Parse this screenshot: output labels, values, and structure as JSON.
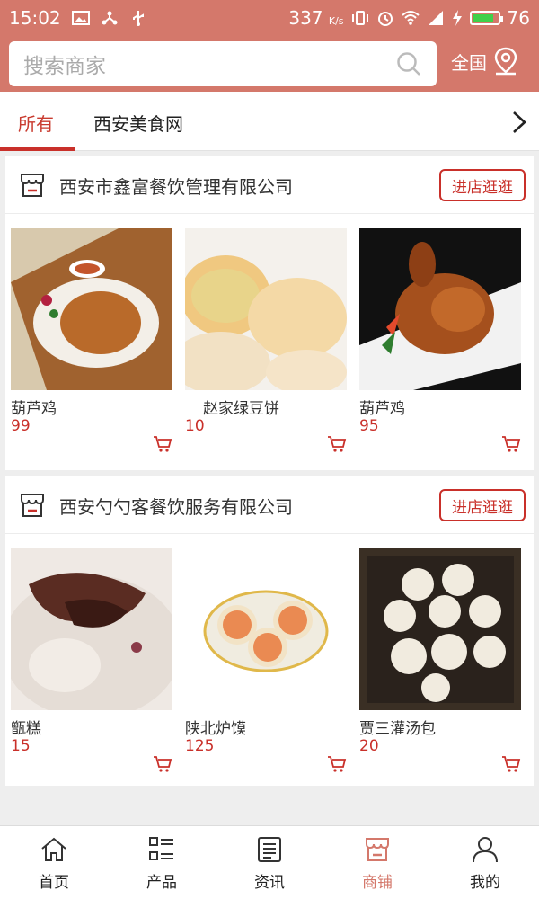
{
  "status_bar": {
    "time": "15:02",
    "speed": "337",
    "speed_unit": "K/s",
    "battery": "76",
    "icons": [
      "image-icon",
      "share-icon",
      "usb-icon",
      "vibrate-icon",
      "alarm-icon",
      "wifi-icon",
      "signal-4g-icon",
      "charging-icon",
      "battery-icon"
    ]
  },
  "search": {
    "placeholder": "搜索商家",
    "region_label": "全国"
  },
  "tabs": [
    {
      "label": "所有",
      "active": true
    },
    {
      "label": "西安美食网",
      "active": false
    }
  ],
  "shops": [
    {
      "name": "西安市鑫富餐饮管理有限公司",
      "enter_label": "进店逛逛",
      "products": [
        {
          "name": "葫芦鸡",
          "price": "99"
        },
        {
          "name": "赵家绿豆饼",
          "price": "10"
        },
        {
          "name": "葫芦鸡",
          "price": "95"
        }
      ]
    },
    {
      "name": "西安勺勺客餐饮服务有限公司",
      "enter_label": "进店逛逛",
      "products": [
        {
          "name": "甑糕",
          "price": "15"
        },
        {
          "name": "陕北炉馍",
          "price": "125"
        },
        {
          "name": "贾三灌汤包",
          "price": "20"
        }
      ]
    }
  ],
  "bottom_nav": [
    {
      "label": "首页",
      "icon": "home-icon"
    },
    {
      "label": "产品",
      "icon": "grid-list-icon"
    },
    {
      "label": "资讯",
      "icon": "news-icon"
    },
    {
      "label": "商铺",
      "icon": "shop-icon",
      "active": true
    },
    {
      "label": "我的",
      "icon": "user-icon"
    }
  ],
  "colors": {
    "brand": "#d4786b",
    "accent": "#c9302a",
    "price": "#c9302a"
  }
}
